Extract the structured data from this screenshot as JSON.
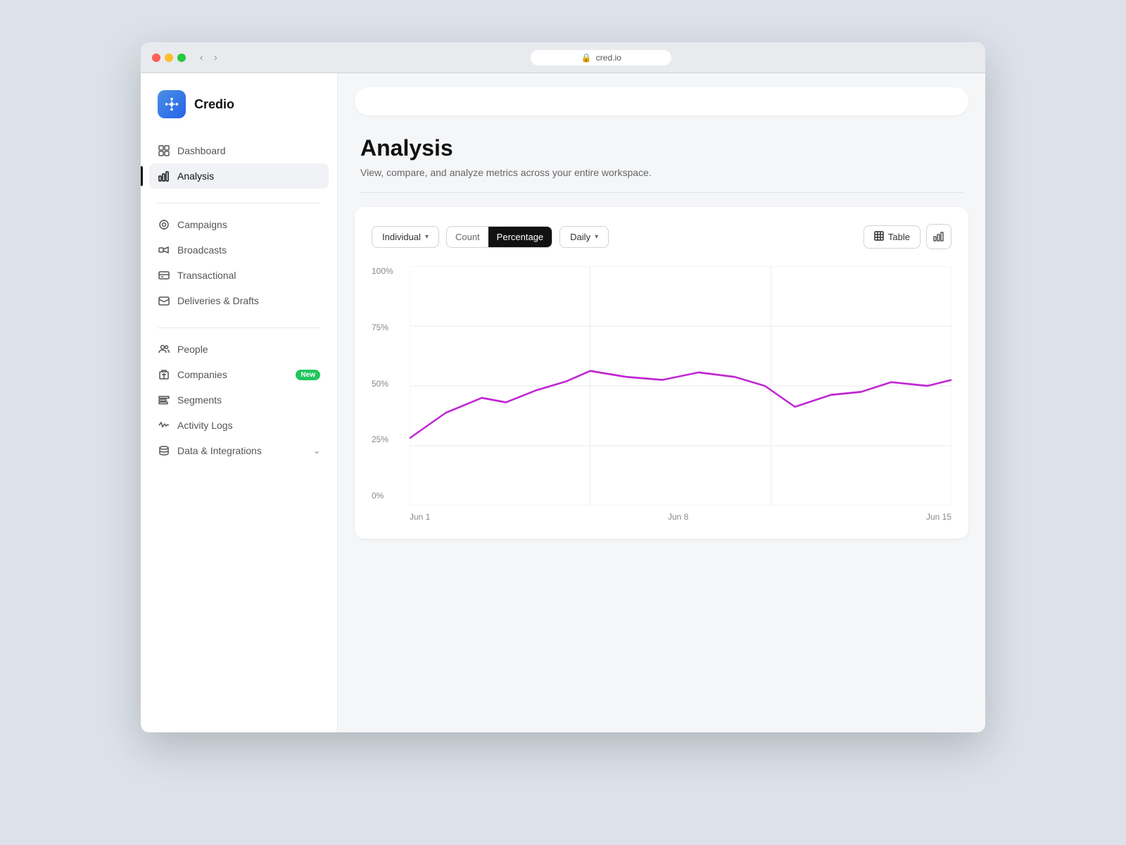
{
  "browser": {
    "url": "cred.io",
    "dots": [
      "red",
      "yellow",
      "green"
    ]
  },
  "sidebar": {
    "logo_text": "Credio",
    "nav_main": [
      {
        "id": "dashboard",
        "label": "Dashboard",
        "icon": "dashboard-icon"
      },
      {
        "id": "analysis",
        "label": "Analysis",
        "icon": "analysis-icon",
        "active": true
      }
    ],
    "nav_channels": [
      {
        "id": "campaigns",
        "label": "Campaigns",
        "icon": "campaigns-icon"
      },
      {
        "id": "broadcasts",
        "label": "Broadcasts",
        "icon": "broadcasts-icon"
      },
      {
        "id": "transactional",
        "label": "Transactional",
        "icon": "transactional-icon"
      },
      {
        "id": "deliveries-drafts",
        "label": "Deliveries & Drafts",
        "icon": "deliveries-icon"
      }
    ],
    "nav_data": [
      {
        "id": "people",
        "label": "People",
        "icon": "people-icon"
      },
      {
        "id": "companies",
        "label": "Companies",
        "icon": "companies-icon",
        "badge": "New"
      },
      {
        "id": "segments",
        "label": "Segments",
        "icon": "segments-icon"
      },
      {
        "id": "activity-logs",
        "label": "Activity Logs",
        "icon": "activity-icon"
      },
      {
        "id": "data-integrations",
        "label": "Data & Integrations",
        "icon": "data-icon",
        "has_chevron": true
      }
    ]
  },
  "main": {
    "page_title": "Analysis",
    "page_subtitle": "View, compare, and analyze metrics across your entire workspace.",
    "chart": {
      "filter_individual": "Individual",
      "filter_count": "Count",
      "filter_percentage": "Percentage",
      "filter_daily": "Daily",
      "view_table": "Table",
      "y_labels": [
        "100%",
        "75%",
        "50%",
        "25%",
        "0%"
      ],
      "x_labels": [
        "Jun 1",
        "Jun 8",
        "Jun 15"
      ],
      "line_color": "#c026d3"
    }
  }
}
